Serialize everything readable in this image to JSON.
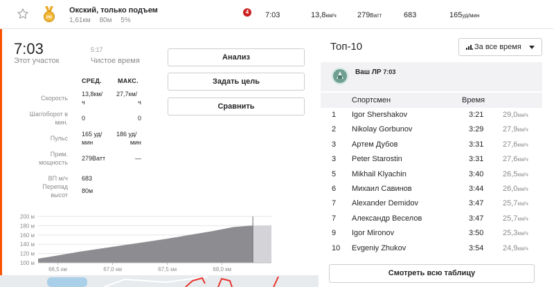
{
  "segment": {
    "name": "Окский, только подъем",
    "distance": "1,61км",
    "elevation": "80м",
    "grade": "5%",
    "rank_badge": "4",
    "time": "7:03",
    "speed": "13,8",
    "speed_unit": "км/ч",
    "power": "279",
    "power_unit": "Ватт",
    "cadence": "683",
    "hr": "165",
    "hr_unit": "уд/мин",
    "medal_label": "PR"
  },
  "effort": {
    "time": "7:03",
    "time_label": "Этот участок",
    "moving_time": "5:17",
    "moving_label": "Чистое время"
  },
  "actions": {
    "analysis": "Анализ",
    "set_goal": "Задать цель",
    "compare": "Сравнить"
  },
  "stats": {
    "avg_header": "СРЕД.",
    "max_header": "МАКС.",
    "rows": [
      {
        "label1": "Скорость",
        "label2": "",
        "avg1": "13,8км/",
        "avg2": "ч",
        "max1": "27,7км/",
        "max2": "ч"
      },
      {
        "label1": "Шаг/оборот в",
        "label2": "мин.",
        "avg1": "0",
        "avg2": "",
        "max1": "0",
        "max2": ""
      },
      {
        "label1": "Пульс",
        "label2": "",
        "avg1": "165 уд/",
        "avg2": "мин",
        "max1": "186 уд/",
        "max2": "мин"
      },
      {
        "label1": "Прим.",
        "label2": "мощность",
        "avg1": "279Ватт",
        "avg2": "",
        "max1": "—",
        "max2": ""
      },
      {
        "label1": "ВП м/ч",
        "label2": "",
        "avg1": "683",
        "avg2": "",
        "max1": "",
        "max2": ""
      },
      {
        "label1": "Перепад",
        "label2": "высот",
        "avg1": "80м",
        "avg2": "",
        "max1": "",
        "max2": ""
      }
    ]
  },
  "chart_data": {
    "type": "area",
    "title": "",
    "xlabel": "",
    "ylabel": "",
    "y_ticks": [
      "200 м",
      "180 м",
      "160 м",
      "140 м",
      "120 м",
      "100 м"
    ],
    "x_ticks": [
      "66,5 км",
      "67,0 км",
      "67,5 км",
      "68,0 км"
    ],
    "x_tick_values": [
      66.5,
      67.0,
      67.5,
      68.0
    ],
    "xlim": [
      66.32,
      68.45
    ],
    "ylim": [
      100,
      200
    ],
    "x": [
      66.32,
      66.4,
      66.55,
      66.7,
      66.9,
      67.1,
      67.3,
      67.5,
      67.7,
      67.9,
      68.1,
      68.25,
      68.45
    ],
    "y": [
      109,
      112,
      118,
      124,
      131,
      138,
      145,
      152,
      160,
      168,
      177,
      180,
      181
    ],
    "highlight_x": [
      66.32,
      68.28
    ],
    "colors": {
      "fill": "#8d8d91",
      "fill_after": "#d4d4d8",
      "grid": "#e6e6e6"
    }
  },
  "leaderboard": {
    "title": "Топ-10",
    "filter": "За все время",
    "your_pr_label": "Ваш ЛР",
    "your_pr_time": "7:03",
    "col_athlete": "Спортсмен",
    "col_time": "Время",
    "speed_unit": "км/ч",
    "rows": [
      {
        "rank": "1",
        "name": "Igor Shershakov",
        "time": "3:21",
        "speed": "29,0"
      },
      {
        "rank": "2",
        "name": "Nikolay Gorbunov",
        "time": "3:29",
        "speed": "27,9"
      },
      {
        "rank": "3",
        "name": "Артем Дубов",
        "time": "3:31",
        "speed": "27,6"
      },
      {
        "rank": "3",
        "name": "Peter Starostin",
        "time": "3:31",
        "speed": "27,6"
      },
      {
        "rank": "5",
        "name": "Mikhail Klyachin",
        "time": "3:40",
        "speed": "26,5"
      },
      {
        "rank": "6",
        "name": "Михаил Савинов",
        "time": "3:44",
        "speed": "26,0"
      },
      {
        "rank": "7",
        "name": "Alexander Demidov",
        "time": "3:47",
        "speed": "25,7"
      },
      {
        "rank": "7",
        "name": "Александр Веселов",
        "time": "3:47",
        "speed": "25,7"
      },
      {
        "rank": "9",
        "name": "Igor Mironov",
        "time": "3:50",
        "speed": "25,3"
      },
      {
        "rank": "10",
        "name": "Evgeniy Zhukov",
        "time": "3:54",
        "speed": "24,9"
      }
    ],
    "full_table": "Смотреть всю таблицу"
  },
  "colors": {
    "accent": "#fc5200",
    "badge": "#cc1f1f",
    "medal": "#e8a825"
  }
}
